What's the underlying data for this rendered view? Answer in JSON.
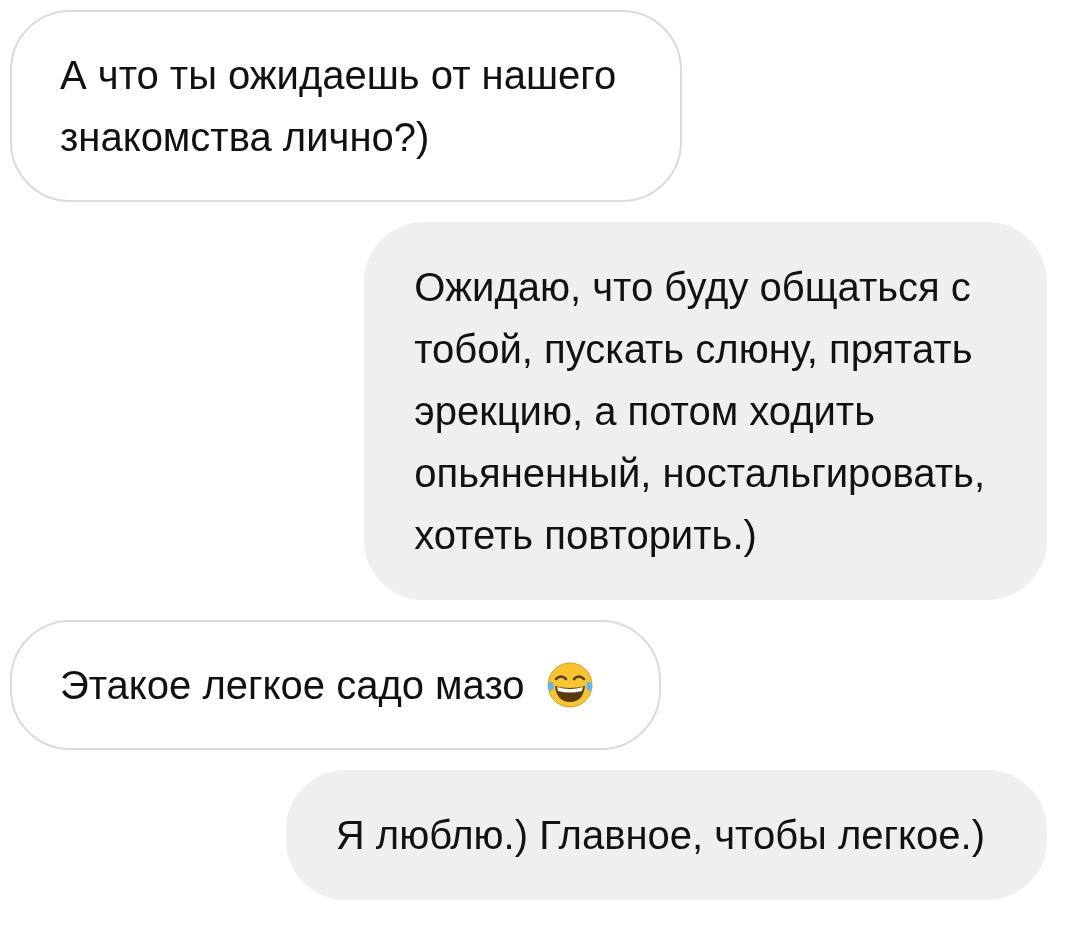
{
  "messages": [
    {
      "kind": "incoming",
      "lines": [
        "А что ты ожидаешь от нашего",
        "знакомства лично?)"
      ],
      "emoji": false
    },
    {
      "kind": "outgoing",
      "lines": [
        "Ожидаю, что буду общаться с",
        "тобой, пускать слюну, прятать",
        "эрекцию, а потом ходить",
        "опьяненный, ностальгировать,",
        "хотеть повторить.)"
      ],
      "emoji": false
    },
    {
      "kind": "incoming",
      "lines": [
        "Этакое легкое садо мазо"
      ],
      "emoji": true
    },
    {
      "kind": "outgoing",
      "lines": [
        "Я люблю.) Главное, чтобы легкое.)"
      ],
      "emoji": false
    }
  ]
}
